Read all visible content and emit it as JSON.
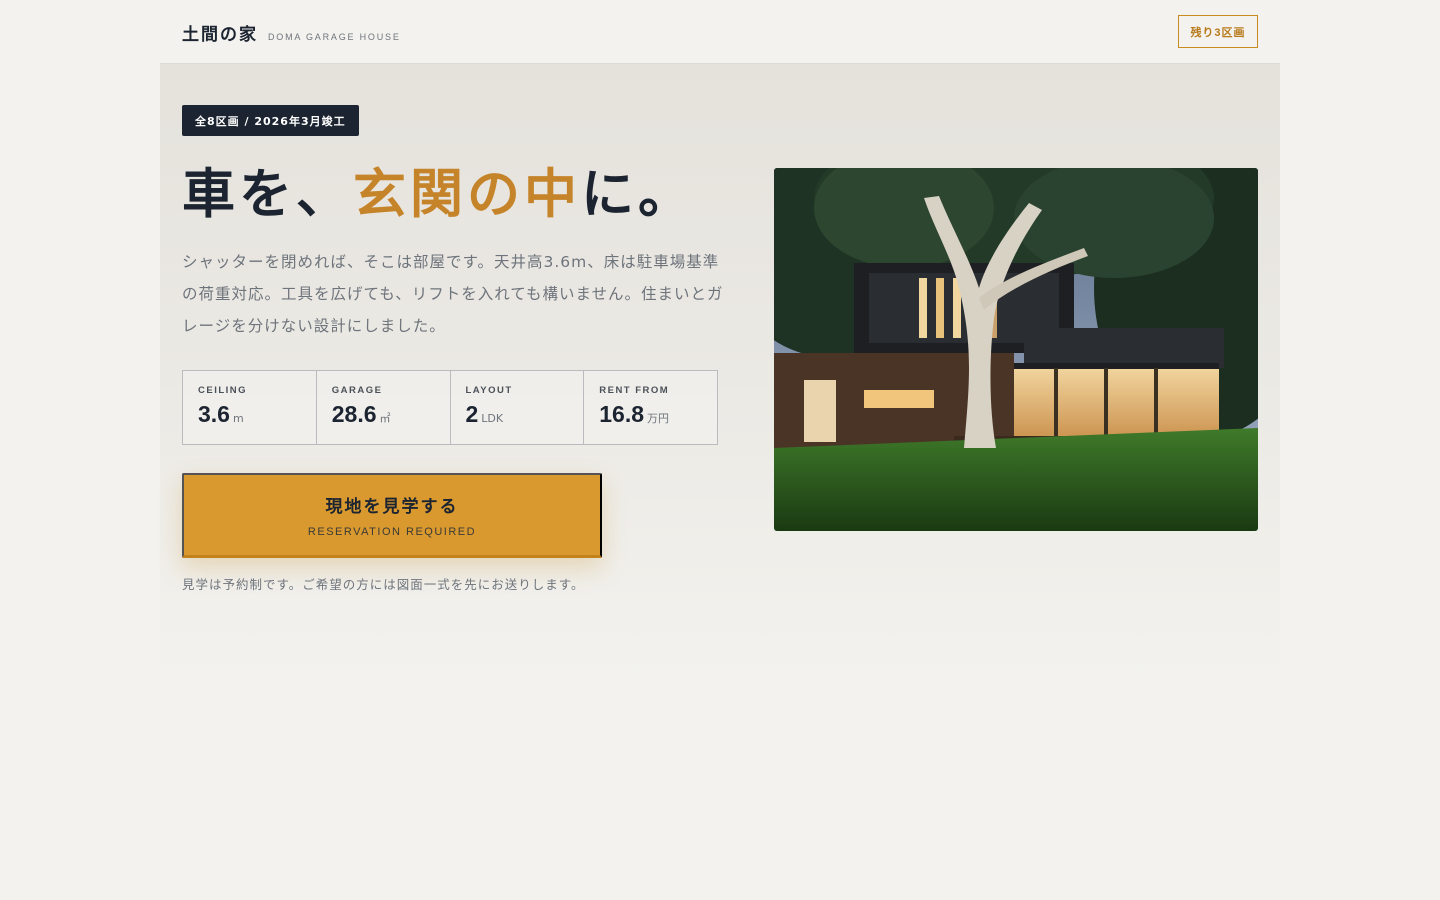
{
  "header": {
    "brand_name": "土間の家",
    "brand_sub": "DOMA GARAGE HOUSE",
    "remaining_label": "残り3区画"
  },
  "hero": {
    "badge": "全8区画 / 2026年3月竣工",
    "headline_part1": "車を、",
    "headline_accent": "玄関の中",
    "headline_part2": "に。",
    "lead": "シャッターを閉めれば、そこは部屋です。天井高3.6m、床は駐車場基準の荷重対応。工具を広げても、リフトを入れても構いません。住まいとガレージを分けない設計にしました。",
    "specs": [
      {
        "label": "CEILING",
        "value": "3.6",
        "unit": "m"
      },
      {
        "label": "GARAGE",
        "value": "28.6",
        "unit": "㎡"
      },
      {
        "label": "LAYOUT",
        "value": "2",
        "unit": "LDK"
      },
      {
        "label": "RENT FROM",
        "value": "16.8",
        "unit": "万円"
      }
    ],
    "cta_title": "現地を見学する",
    "cta_sub": "RESERVATION REQUIRED",
    "note": "見学は予約制です。ご希望の方には図面一式を先にお送りします。"
  },
  "colors": {
    "accent": "#c5842a",
    "cta_bg": "#d9992e",
    "dark": "#1b2430",
    "background": "#f3f2ee"
  }
}
